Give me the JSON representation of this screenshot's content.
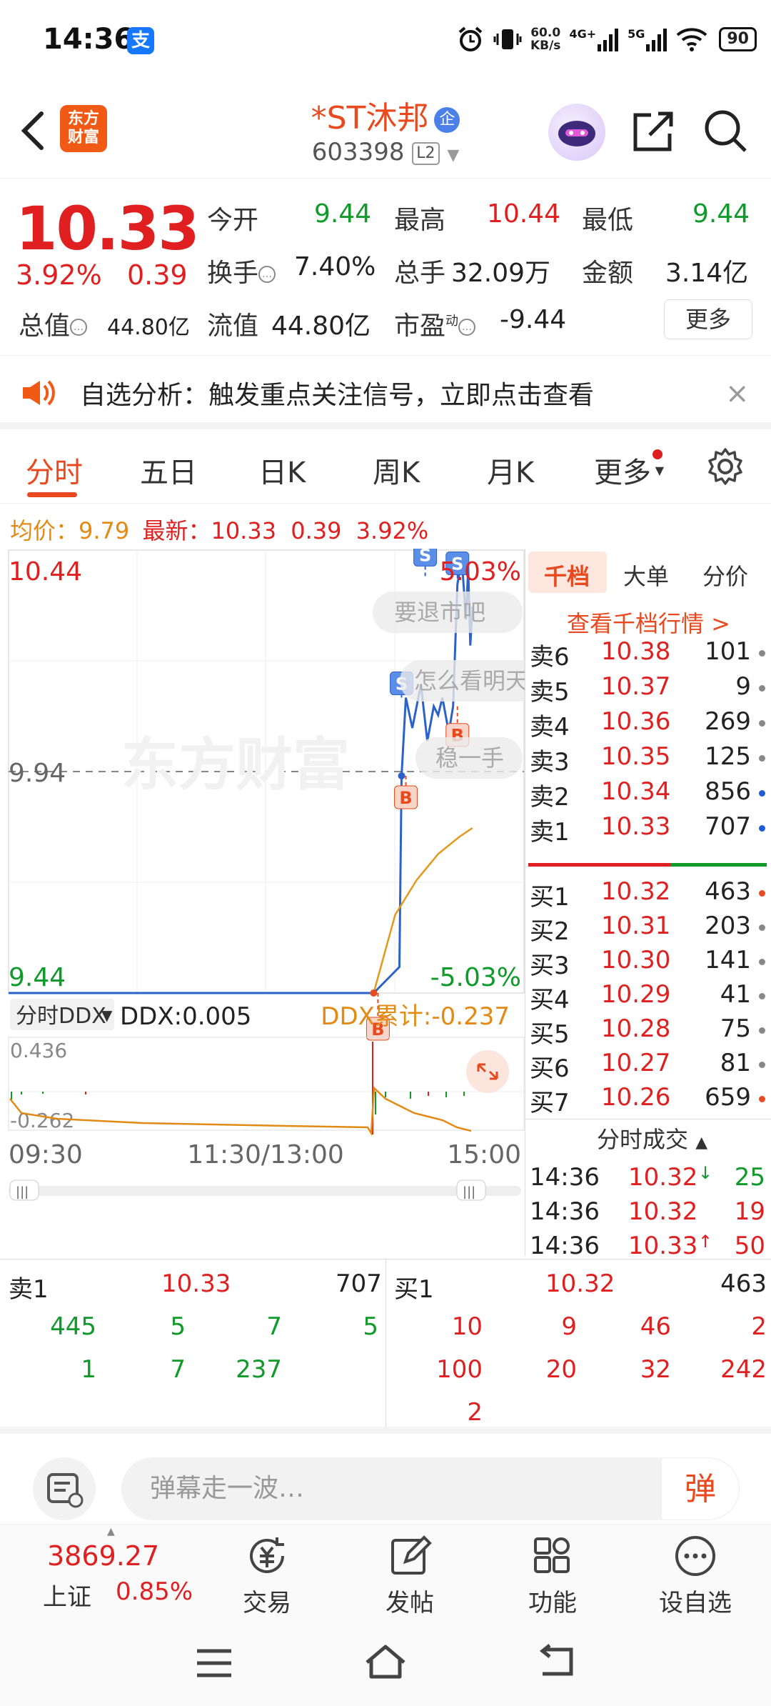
{
  "status": {
    "time": "14:36",
    "speed_value": "60.0",
    "speed_unit": "KB/s",
    "net1": "4G+",
    "net2": "5G",
    "battery": "90"
  },
  "header": {
    "title": "*ST沐邦",
    "qi_badge": "企",
    "code": "603398",
    "level": "L2",
    "logo_line1": "东方",
    "logo_line2": "财富"
  },
  "quote": {
    "price": "10.33",
    "change_pct": "3.92%",
    "change_abs": "0.39",
    "open_label": "今开",
    "open": "9.44",
    "high_label": "最高",
    "high": "10.44",
    "low_label": "最低",
    "low": "9.44",
    "turnover_label": "换手",
    "turnover": "7.40%",
    "volume_label": "总手",
    "volume": "32.09万",
    "amount_label": "金额",
    "amount": "3.14亿",
    "mktcap_label": "总值",
    "mktcap": "44.80亿",
    "float_label": "流值",
    "float": "44.80亿",
    "pe_label": "市盈",
    "pe_sup": "动",
    "pe": "-9.44",
    "more": "更多"
  },
  "banner": {
    "text": "自选分析：触发重点关注信号，立即点击查看",
    "close": "×"
  },
  "tabs": [
    "分时",
    "五日",
    "日K",
    "周K",
    "月K",
    "更多"
  ],
  "price_line": {
    "avg_label": "均价：",
    "avg": "9.79",
    "last_label": "最新：",
    "last": "10.33",
    "chg": "0.39",
    "pct": "3.92%"
  },
  "chart": {
    "y_top": "10.44",
    "y_mid": "9.94",
    "y_bottom": "9.44",
    "pct_top": "5.03%",
    "pct_bottom": "-5.03%",
    "x_labels": [
      "09:30",
      "11:30/13:00",
      "15:00"
    ],
    "watermark": "东方财富",
    "bubbles": [
      "要退市吧",
      "怎么看明天",
      "稳一手"
    ],
    "ddx_selector": "分时DDX",
    "ddx_label": "DDX:0.005",
    "ddx_cum": "DDX累计:-0.237",
    "ddx_top": "0.436",
    "ddx_bottom": "-0.262"
  },
  "chart_data": {
    "type": "line",
    "title": "",
    "xlabel": "",
    "ylabel": "",
    "x_ticks": [
      "09:30",
      "11:30/13:00",
      "15:00"
    ],
    "ylim": [
      9.44,
      10.44
    ],
    "series": [
      {
        "values_x": [
          "09:30",
          "13:00",
          "13:50",
          "14:02",
          "14:03",
          "14:05",
          "14:08",
          "14:12",
          "14:15",
          "14:18",
          "14:20",
          "14:22",
          "14:25",
          "14:27",
          "14:29",
          "14:31",
          "14:33",
          "14:34",
          "14:35",
          "14:36"
        ],
        "values": [
          9.44,
          9.44,
          9.44,
          9.5,
          9.94,
          10.12,
          10.05,
          10.15,
          10.02,
          10.1,
          10.08,
          10.12,
          10.04,
          10.1,
          10.38,
          10.44,
          10.3,
          10.42,
          10.24,
          10.33
        ]
      },
      {
        "values_x": [
          "13:50",
          "14:00",
          "14:10",
          "14:20",
          "14:30",
          "14:36"
        ],
        "values": [
          9.44,
          9.62,
          9.7,
          9.76,
          9.8,
          9.82
        ]
      }
    ],
    "markers": [
      "B",
      "B",
      "S",
      "S",
      "S",
      "B"
    ]
  },
  "panel": {
    "tabs": [
      "千档",
      "大单",
      "分价"
    ],
    "link": "查看千档行情 >",
    "sells": [
      {
        "label": "卖6",
        "price": "10.38",
        "vol": "101",
        "dot": "#888888"
      },
      {
        "label": "卖5",
        "price": "10.37",
        "vol": "9",
        "dot": "#888888"
      },
      {
        "label": "卖4",
        "price": "10.36",
        "vol": "269",
        "dot": "#888888"
      },
      {
        "label": "卖3",
        "price": "10.35",
        "vol": "125",
        "dot": "#888888"
      },
      {
        "label": "卖2",
        "price": "10.34",
        "vol": "856",
        "dot": "#1e5dd6"
      },
      {
        "label": "卖1",
        "price": "10.33",
        "vol": "707",
        "dot": "#1e5dd6"
      }
    ],
    "buys": [
      {
        "label": "买1",
        "price": "10.32",
        "vol": "463",
        "dot": "#e8491f"
      },
      {
        "label": "买2",
        "price": "10.31",
        "vol": "203",
        "dot": "#888888"
      },
      {
        "label": "买3",
        "price": "10.30",
        "vol": "141",
        "dot": "#888888"
      },
      {
        "label": "买4",
        "price": "10.29",
        "vol": "41",
        "dot": "#888888"
      },
      {
        "label": "买5",
        "price": "10.28",
        "vol": "75",
        "dot": "#888888"
      },
      {
        "label": "买6",
        "price": "10.27",
        "vol": "81",
        "dot": "#888888"
      },
      {
        "label": "买7",
        "price": "10.26",
        "vol": "659",
        "dot": "#e8491f"
      }
    ],
    "trades_title": "分时成交",
    "trades": [
      {
        "time": "14:36",
        "price": "10.32",
        "arrow": "↓",
        "vol": "25"
      },
      {
        "time": "14:36",
        "price": "10.32",
        "arrow": "",
        "vol": "19"
      },
      {
        "time": "14:36",
        "price": "10.33",
        "arrow": "↑",
        "vol": "50"
      }
    ]
  },
  "queue": {
    "sell_label": "卖1",
    "sell_price": "10.33",
    "sell_vol": "707",
    "buy_label": "买1",
    "buy_price": "10.32",
    "buy_vol": "463",
    "sell_rows": [
      [
        "445",
        "5",
        "7",
        "5"
      ],
      [
        "1",
        "7",
        "237",
        ""
      ]
    ],
    "buy_rows": [
      [
        "10",
        "9",
        "46",
        "2"
      ],
      [
        "100",
        "20",
        "32",
        "242"
      ],
      [
        "2",
        "",
        "",
        ""
      ]
    ]
  },
  "comment": {
    "placeholder": "弹幕走一波…",
    "btn": "弹"
  },
  "bottom_nav": {
    "index_value": "3869.27",
    "index_name": "上证",
    "index_pct": "0.85%",
    "items": [
      "交易",
      "发帖",
      "功能",
      "设自选"
    ]
  }
}
